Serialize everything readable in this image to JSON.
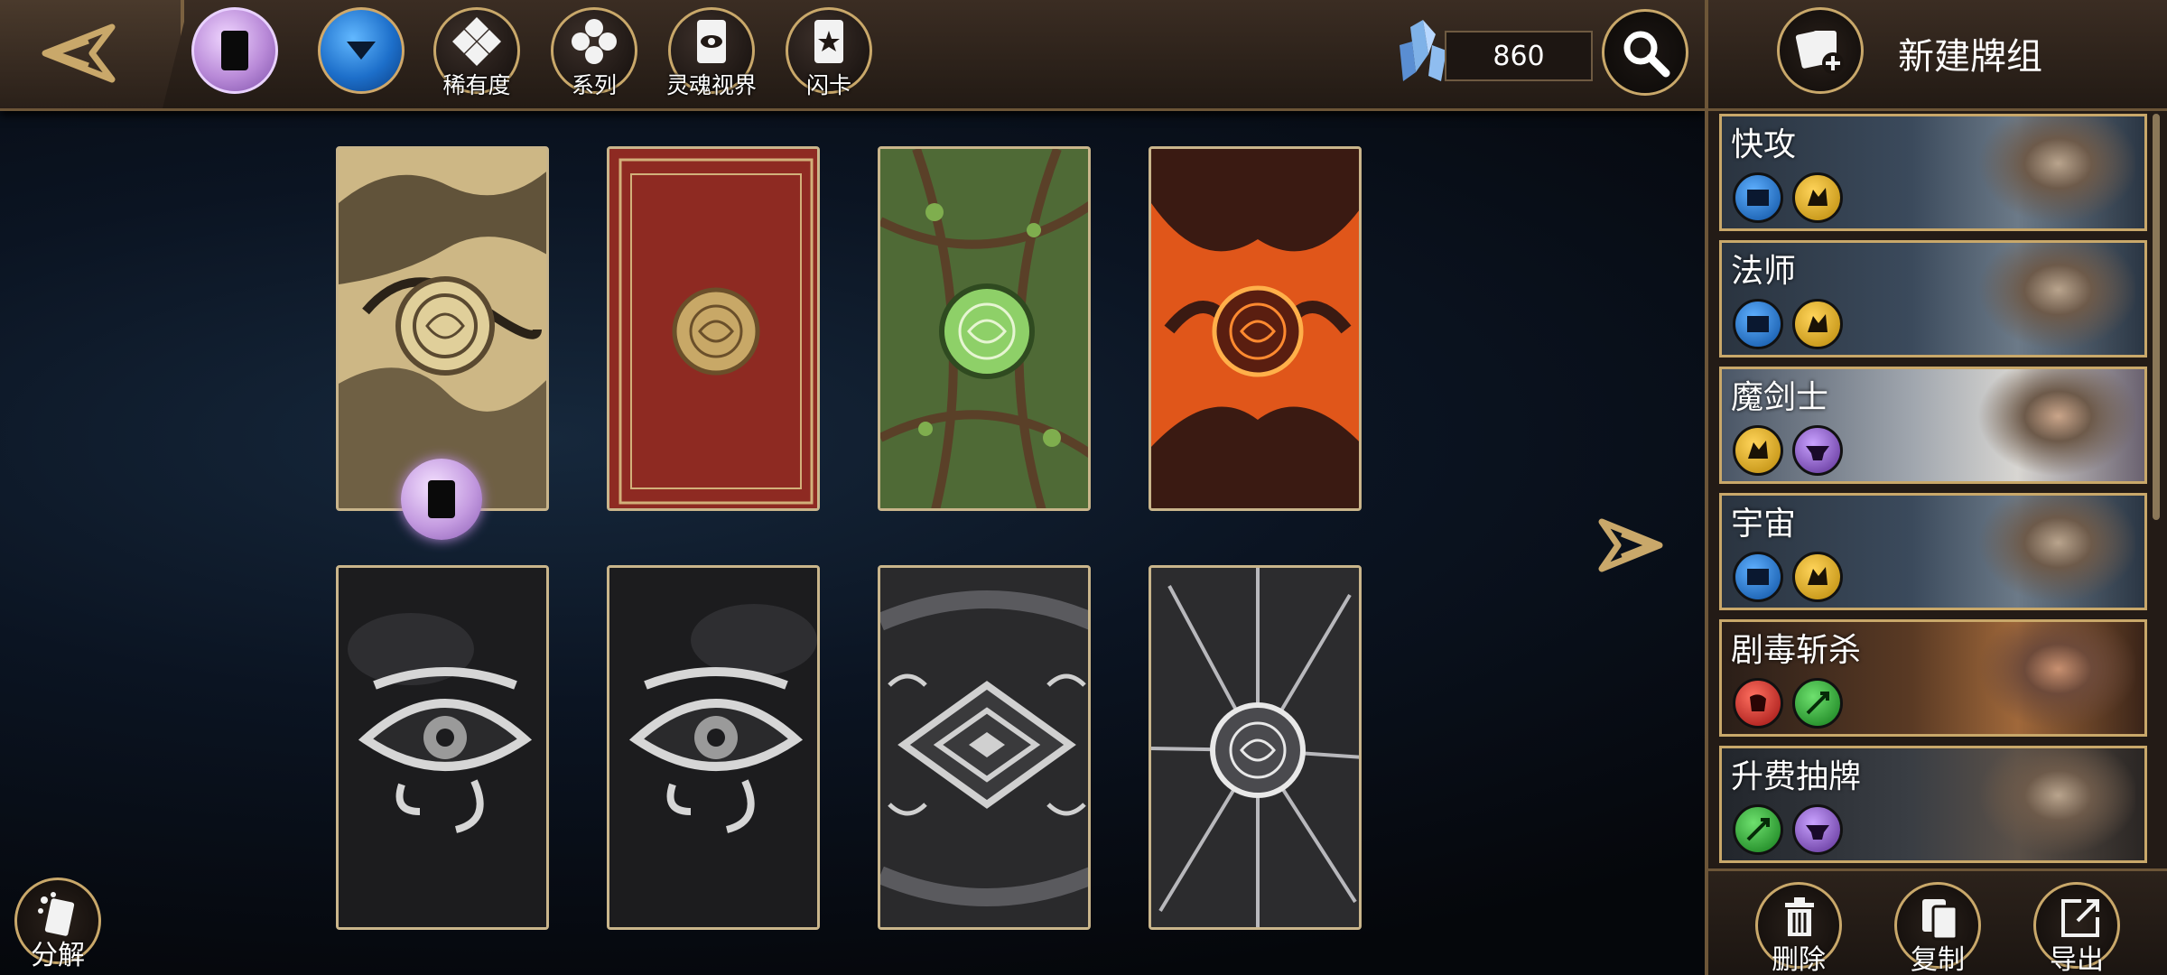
{
  "topbar": {
    "filters": [
      {
        "id": "owned",
        "label": "",
        "icon": "card-back-icon"
      },
      {
        "id": "dropdown",
        "label": "",
        "icon": "chevron-down-icon"
      },
      {
        "id": "rarity",
        "label": "稀有度",
        "icon": "diamond-grid-icon"
      },
      {
        "id": "series",
        "label": "系列",
        "icon": "cluster-icon"
      },
      {
        "id": "soul_view",
        "label": "灵魂视界",
        "icon": "eye-card-icon"
      },
      {
        "id": "flash_card",
        "label": "闪卡",
        "icon": "star-card-icon"
      }
    ],
    "crystal_count": "860"
  },
  "right_panel": {
    "new_deck_label": "新建牌组",
    "decks": [
      {
        "name": "快攻",
        "gems": [
          "blue",
          "gold"
        ]
      },
      {
        "name": "法师",
        "gems": [
          "blue",
          "gold"
        ]
      },
      {
        "name": "魔剑士",
        "gems": [
          "gold",
          "purple"
        ]
      },
      {
        "name": "宇宙",
        "gems": [
          "blue",
          "gold"
        ]
      },
      {
        "name": "剧毒斩杀",
        "gems": [
          "red",
          "green"
        ]
      },
      {
        "name": "升费抽牌",
        "gems": [
          "green",
          "purple"
        ]
      }
    ],
    "actions": {
      "delete": "删除",
      "copy": "复制",
      "export": "导出"
    }
  },
  "main": {
    "disassemble_label": "分解",
    "card_backs": [
      {
        "style": "gold-dragon",
        "equipped": true
      },
      {
        "style": "red-rune"
      },
      {
        "style": "green-vines"
      },
      {
        "style": "lava"
      },
      {
        "style": "silver-eye"
      },
      {
        "style": "silver-eye-2"
      },
      {
        "style": "silver-diamond"
      },
      {
        "style": "silver-crack"
      }
    ]
  },
  "colors": {
    "gold": "#c9a86a",
    "panel": "#231b16",
    "bg": "#06080d"
  }
}
